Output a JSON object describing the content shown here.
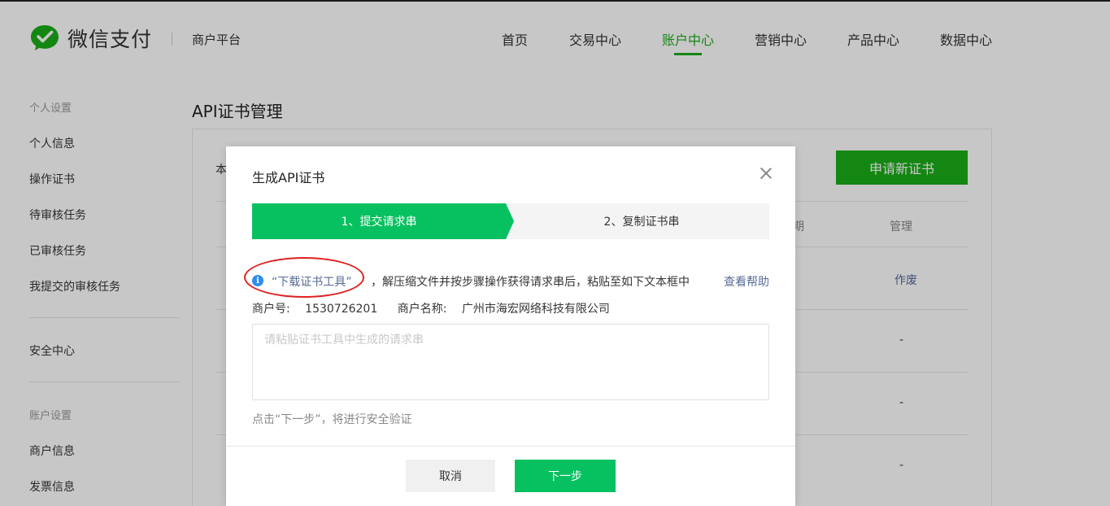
{
  "header": {
    "logo_text": "微信支付",
    "platform": "商户平台",
    "nav": [
      {
        "label": "首页",
        "active": false
      },
      {
        "label": "交易中心",
        "active": false
      },
      {
        "label": "账户中心",
        "active": true
      },
      {
        "label": "营销中心",
        "active": false
      },
      {
        "label": "产品中心",
        "active": false
      },
      {
        "label": "数据中心",
        "active": false
      }
    ]
  },
  "sidebar": {
    "group_personal": "个人设置",
    "personal_items": [
      "个人信息",
      "操作证书",
      "待审核任务",
      "已审核任务",
      "我提交的审核任务"
    ],
    "security": "安全中心",
    "group_account": "账户设置",
    "account_items": [
      "商户信息",
      "发票信息"
    ]
  },
  "main": {
    "page_title": "API证书管理",
    "apply_button": "申请新证书",
    "partial_label": "本",
    "col_manage": "管理",
    "col_partial": "期",
    "row_action": "作废",
    "dash": "-"
  },
  "modal": {
    "title": "生成API证书",
    "step1": "1、提交请求串",
    "step2": "2、复制证书串",
    "download_link": "“下载证书工具”",
    "info_text": "，解压缩文件并按步骤操作获得请求串后，粘贴至如下文本框中",
    "help_link": "查看帮助",
    "merchant_id_label": "商户号:",
    "merchant_id": "1530726201",
    "merchant_name_label": "商户名称:",
    "merchant_name": "广州市海宏网络科技有限公司",
    "textarea_placeholder": "请粘贴证书工具中生成的请求串",
    "hint": "点击“下一步”，将进行安全验证",
    "cancel": "取消",
    "next": "下一步"
  },
  "colors": {
    "brand_green": "#1aad19",
    "step_green": "#07c160",
    "link_blue": "#576b95",
    "info_blue": "#2d8cf0",
    "annotation_red": "#e02020"
  }
}
